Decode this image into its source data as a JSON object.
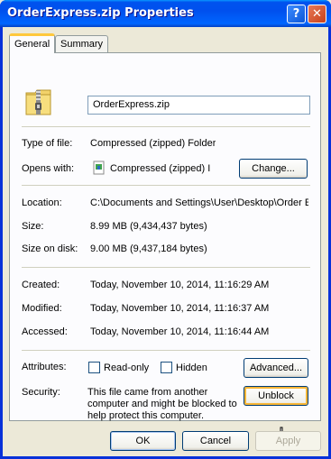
{
  "window": {
    "title": "OrderExpress.zip Properties",
    "help_label": "?",
    "close_label": "✕"
  },
  "tabs": [
    {
      "label": "General"
    },
    {
      "label": "Summary"
    }
  ],
  "general": {
    "file_name": "OrderExpress.zip",
    "type_label": "Type of file:",
    "type_value": "Compressed (zipped) Folder",
    "opens_label": "Opens with:",
    "opens_value": "Compressed (zipped) I",
    "change_button": "Change...",
    "location_label": "Location:",
    "location_value": "C:\\Documents and Settings\\User\\Desktop\\Order E",
    "size_label": "Size:",
    "size_value": "8.99 MB (9,434,437 bytes)",
    "size_on_disk_label": "Size on disk:",
    "size_on_disk_value": "9.00 MB (9,437,184 bytes)",
    "created_label": "Created:",
    "created_value": "Today, November 10, 2014, 11:16:29 AM",
    "modified_label": "Modified:",
    "modified_value": "Today, November 10, 2014, 11:16:37 AM",
    "accessed_label": "Accessed:",
    "accessed_value": "Today, November 10, 2014, 11:16:44 AM",
    "attributes_label": "Attributes:",
    "readonly_label": "Read-only",
    "hidden_label": "Hidden",
    "advanced_button": "Advanced...",
    "security_label": "Security:",
    "security_text_1": "This file came from another",
    "security_text_2": "computer and might be blocked to",
    "security_text_3": "help protect this computer.",
    "unblock_button": "Unblock"
  },
  "footer": {
    "ok": "OK",
    "cancel": "Cancel",
    "apply": "Apply"
  }
}
